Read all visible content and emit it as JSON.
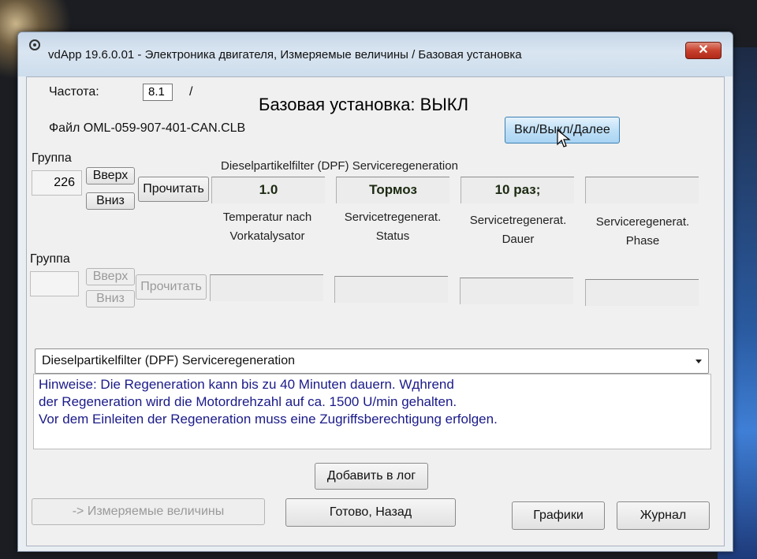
{
  "window": {
    "title": "vdApp 19.6.0.01 - Электроника двигателя,  Измеряемые величины / Базовая установка",
    "close_glyph": "✕"
  },
  "header": {
    "frequency_label": "Частота:",
    "frequency_value": "8.1",
    "frequency_unit": "/",
    "file_label": "Файл OML-059-907-401-CAN.CLB",
    "basic_setting_title": "Базовая установка: ВЫКЛ",
    "toggle_button": "Вкл/Выкл/Далее"
  },
  "group1": {
    "label": "Группа",
    "number": "226",
    "up_button": "Вверх",
    "down_button": "Вниз",
    "read_button": "Прочитать",
    "group_title": "Dieselpartikelfilter (DPF) Serviceregeneration",
    "fields": [
      {
        "value": "1.0",
        "caption_line1": "Temperatur nach",
        "caption_line2": "Vorkatalysator"
      },
      {
        "value": "Тормоз",
        "caption_line1": "Servicetregenerat.",
        "caption_line2": "Status"
      },
      {
        "value": "10 раз;",
        "caption_line1": "Servicetregenerat.",
        "caption_line2": "Dauer"
      },
      {
        "value": "",
        "caption_line1": "Serviceregenerat.",
        "caption_line2": "Phase"
      }
    ]
  },
  "group2": {
    "label": "Группа",
    "number": "",
    "up_button": "Вверх",
    "down_button": "Вниз",
    "read_button": "Прочитать"
  },
  "selector": {
    "selected": "Dieselpartikelfilter (DPF) Serviceregeneration"
  },
  "notes": {
    "line1": "Hinweise: Die Regeneration kann bis zu 40 Minuten dauern. Wдhrend",
    "line2": "der Regeneration wird die Motordrehzahl auf ca. 1500 U/min gehalten.",
    "line3": "Vor dem Einleiten der Regeneration muss eine Zugriffsberechtigung erfolgen."
  },
  "footer": {
    "add_to_log": "Добавить в лог",
    "measured_values": "-> Измеряемые величины",
    "done_back": "Готово, Назад",
    "graphs": "Графики",
    "journal": "Журнал"
  }
}
